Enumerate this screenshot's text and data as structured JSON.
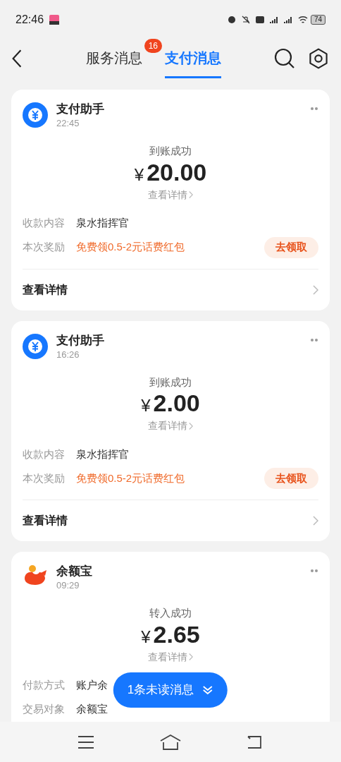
{
  "status_bar": {
    "time": "22:46",
    "battery": "74"
  },
  "header": {
    "tabs": [
      {
        "label": "服务消息",
        "badge": "16",
        "selected": false
      },
      {
        "label": "支付消息",
        "selected": true
      }
    ]
  },
  "cards": [
    {
      "kind": "assistant",
      "name": "支付助手",
      "time": "22:45",
      "status": "到账成功",
      "currency": "¥",
      "amount": "20.00",
      "details_link": "查看详情",
      "fields": [
        {
          "kind": "plain",
          "label": "收款内容",
          "value": "泉水指挥官"
        },
        {
          "kind": "promo",
          "label": "本次奖励",
          "value": "免费领0.5-2元话费红包",
          "action": "去领取"
        }
      ],
      "footer": "查看详情"
    },
    {
      "kind": "assistant",
      "name": "支付助手",
      "time": "16:26",
      "status": "到账成功",
      "currency": "¥",
      "amount": "2.00",
      "details_link": "查看详情",
      "fields": [
        {
          "kind": "plain",
          "label": "收款内容",
          "value": "泉水指挥官"
        },
        {
          "kind": "promo",
          "label": "本次奖励",
          "value": "免费领0.5-2元话费红包",
          "action": "去领取"
        }
      ],
      "footer": "查看详情"
    },
    {
      "kind": "yuebao",
      "name": "余额宝",
      "time": "09:29",
      "status": "转入成功",
      "currency": "¥",
      "amount": "2.65",
      "details_link": "查看详情",
      "fields": [
        {
          "kind": "plain",
          "label": "付款方式",
          "value": "账户余"
        },
        {
          "kind": "plain",
          "label": "交易对象",
          "value": "余额宝"
        }
      ]
    }
  ],
  "unread_button": {
    "label": "1条未读消息"
  }
}
